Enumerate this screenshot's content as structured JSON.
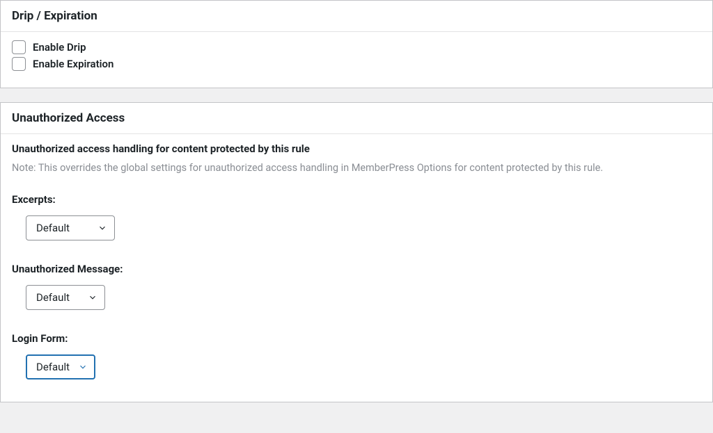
{
  "drip": {
    "title": "Drip / Expiration",
    "enable_drip_label": "Enable Drip",
    "enable_expiration_label": "Enable Expiration"
  },
  "unauthorized": {
    "title": "Unauthorized Access",
    "subheading": "Unauthorized access handling for content protected by this rule",
    "note": "Note: This overrides the global settings for unauthorized access handling in MemberPress Options for content protected by this rule.",
    "excerpts": {
      "label": "Excerpts:",
      "value": "Default"
    },
    "message": {
      "label": "Unauthorized Message:",
      "value": "Default"
    },
    "login_form": {
      "label": "Login Form:",
      "value": "Default"
    }
  }
}
